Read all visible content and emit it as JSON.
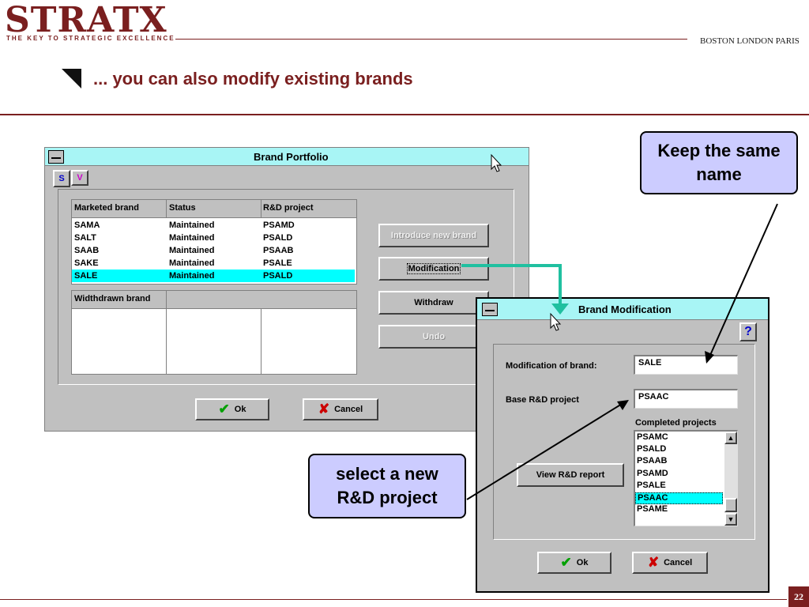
{
  "header": {
    "logo": "STRATX",
    "tagline": "THE KEY TO STRATEGIC EXCELLENCE",
    "cities": "BOSTON LONDON PARIS",
    "title": "... you can also modify existing brands",
    "page_number": "22"
  },
  "portfolio": {
    "title": "Brand Portfolio",
    "tab_s": "S",
    "tab_v": "V",
    "columns": [
      "Marketed brand",
      "Status",
      "R&D project"
    ],
    "rows": [
      [
        "SAMA",
        "Maintained",
        "PSAMD"
      ],
      [
        "SALT",
        "Maintained",
        "PSALD"
      ],
      [
        "SAAB",
        "Maintained",
        "PSAAB"
      ],
      [
        "SAKE",
        "Maintained",
        "PSALE"
      ],
      [
        "SALE",
        "Maintained",
        "PSALD"
      ]
    ],
    "withdrawn_header": "Widthdrawn brand",
    "buttons": {
      "introduce": "Introduce new brand",
      "modification": "Modification",
      "withdraw": "Withdraw",
      "undo": "Undo",
      "ok": "Ok",
      "cancel": "Cancel"
    }
  },
  "modification": {
    "title": "Brand Modification",
    "help": "?",
    "brand_label": "Modification of brand:",
    "brand_value": "SALE",
    "base_label": "Base R&D project",
    "base_value": "PSAAC",
    "completed_label": "Completed projects",
    "projects": [
      "PSAMC",
      "PSALD",
      "PSAAB",
      "PSAMD",
      "PSALE",
      "PSAAC",
      "PSAME"
    ],
    "view_report": "View R&D report",
    "ok": "Ok",
    "cancel": "Cancel"
  },
  "callouts": {
    "keep_name": "Keep the same name",
    "select_project": "select a new R&D project"
  },
  "colors": {
    "brand": "#7a1f1f",
    "titlebar": "#a8f5f5",
    "selection": "#00ffff",
    "callout": "#ccccff",
    "connector": "#20c0a0"
  }
}
